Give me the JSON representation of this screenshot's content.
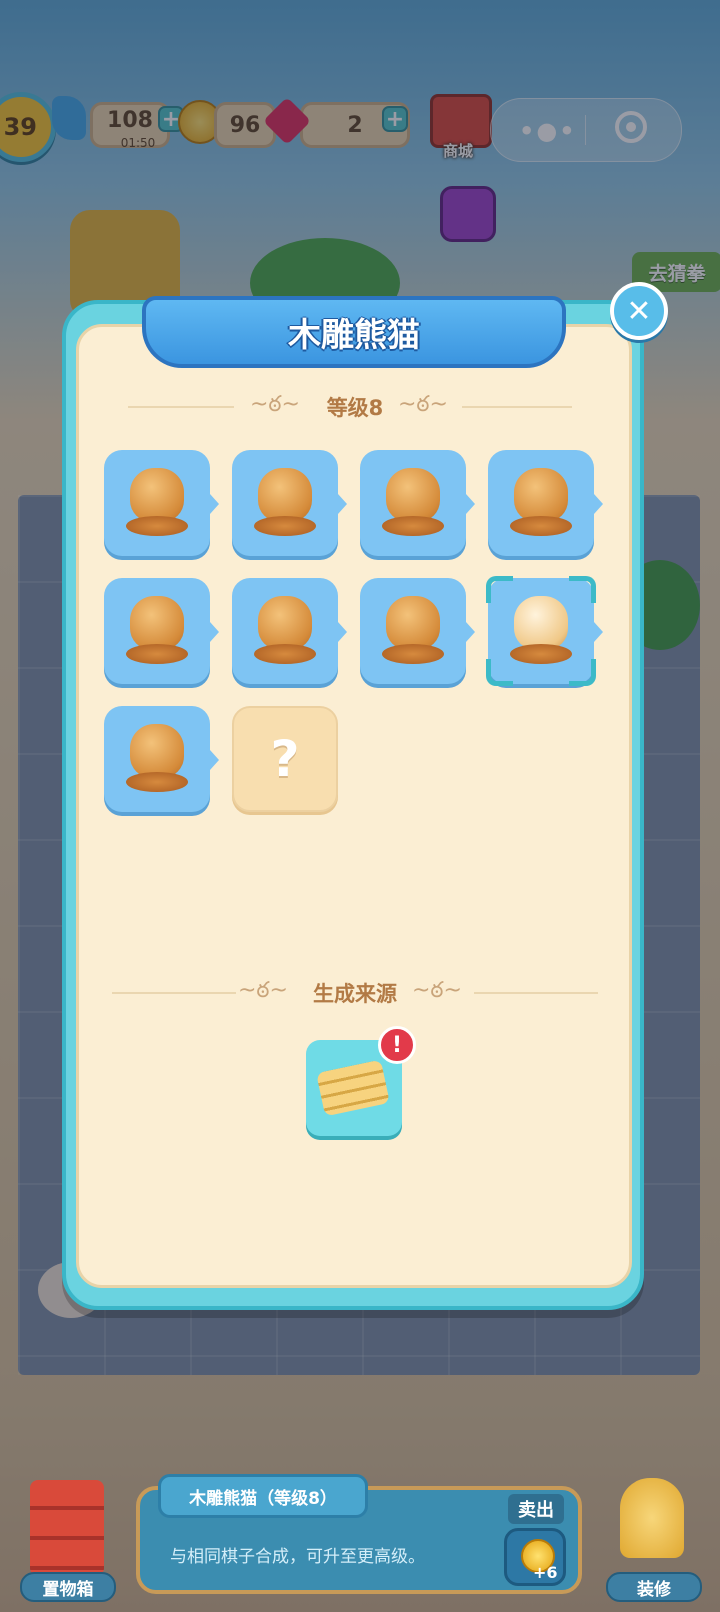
{
  "hud": {
    "level": "39",
    "energy": "108",
    "energy_timer": "01:50",
    "coins": "96",
    "gems": "2",
    "shop_label": "商城"
  },
  "side_buttons": {
    "guess_label": "去猜拳"
  },
  "modal": {
    "title": "木雕熊猫",
    "level_heading": "等级8",
    "items": [
      {
        "name": "frog-statue",
        "state": "unlocked"
      },
      {
        "name": "cat-statue",
        "state": "unlocked"
      },
      {
        "name": "fox-statue",
        "state": "unlocked"
      },
      {
        "name": "pig-statue",
        "state": "unlocked"
      },
      {
        "name": "monkey-statue",
        "state": "unlocked"
      },
      {
        "name": "dolphin-statue",
        "state": "unlocked"
      },
      {
        "name": "pangolin-statue",
        "state": "unlocked"
      },
      {
        "name": "panda-statue",
        "state": "selected"
      },
      {
        "name": "capybara-statue",
        "state": "unlocked"
      },
      {
        "name": "unknown",
        "state": "locked",
        "label": "?"
      }
    ],
    "source_heading": "生成来源",
    "source_alert": "!"
  },
  "bottom": {
    "item_name": "木雕熊猫（等级8）",
    "hint": "与相同棋子合成，可升至更高级。",
    "sell_label": "卖出",
    "sell_value": "+6",
    "storage_label": "置物箱",
    "decor_label": "装修"
  },
  "colors": {
    "modal_frame": "#6ad3e0",
    "title_banner": "#3b95e0",
    "tile": "#7ec4f3",
    "panel": "#fbeed3"
  }
}
